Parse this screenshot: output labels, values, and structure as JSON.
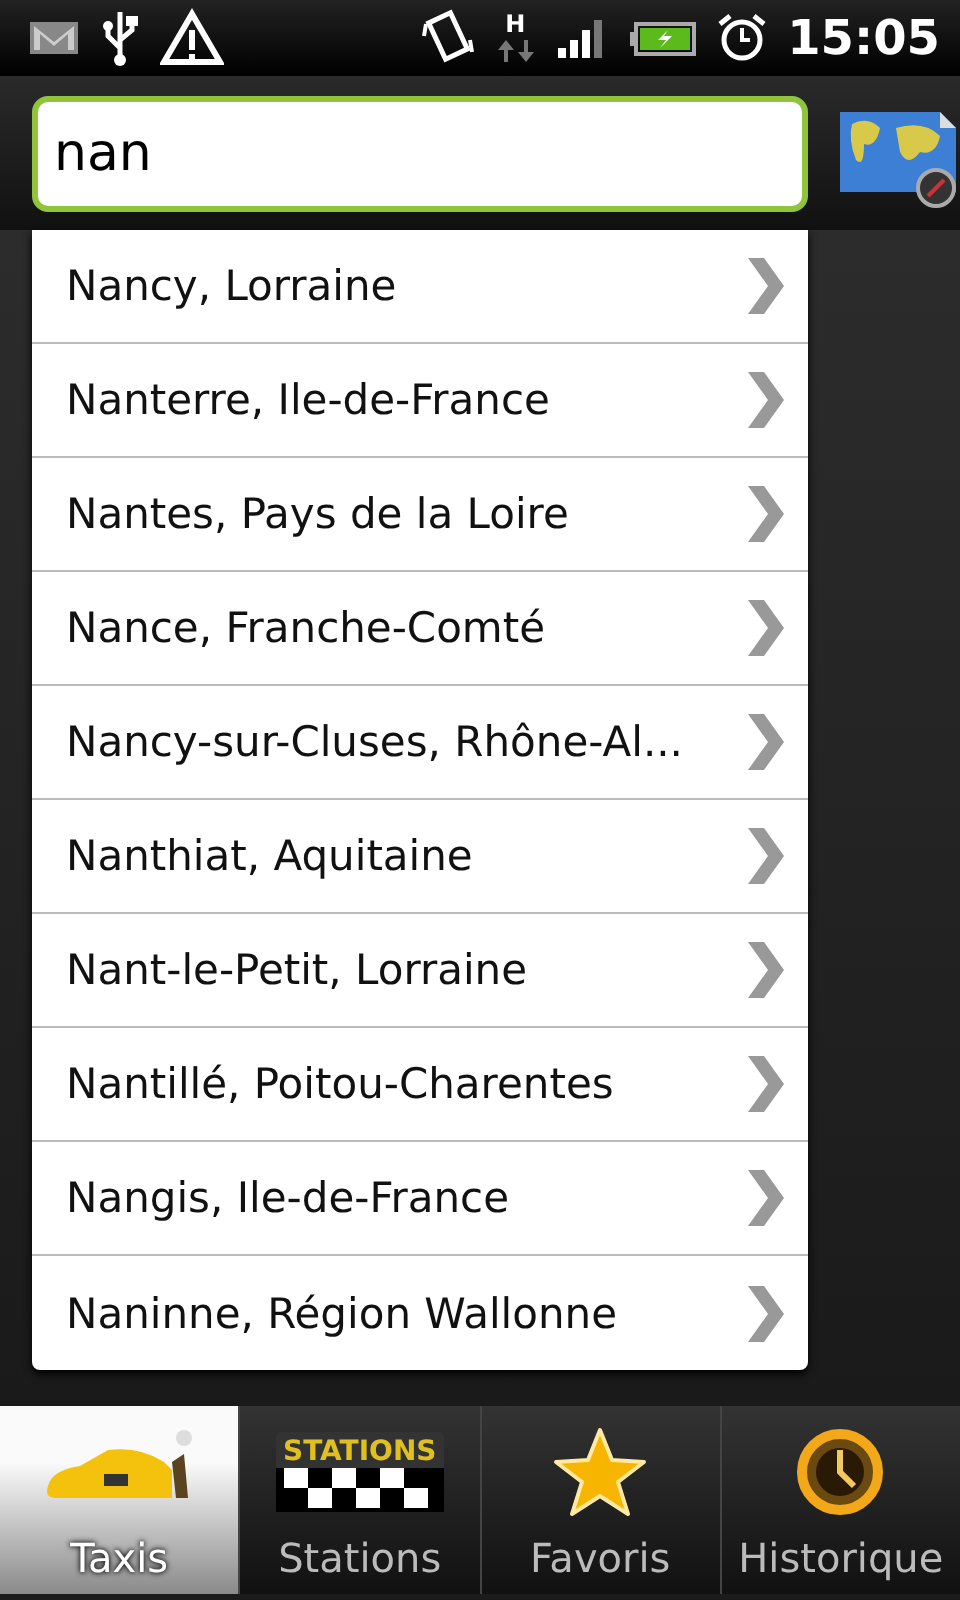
{
  "status_bar": {
    "network_type": "H",
    "time": "15:05"
  },
  "search": {
    "value": "nan"
  },
  "suggestions": [
    {
      "label": "Nancy, Lorraine"
    },
    {
      "label": "Nanterre, Ile-de-France"
    },
    {
      "label": "Nantes, Pays de la Loire"
    },
    {
      "label": "Nance, Franche-Comté"
    },
    {
      "label": "Nancy-sur-Cluses, Rhône-Al..."
    },
    {
      "label": "Nanthiat, Aquitaine"
    },
    {
      "label": "Nant-le-Petit, Lorraine"
    },
    {
      "label": "Nantillé, Poitou-Charentes"
    },
    {
      "label": "Nangis, Ile-de-France"
    },
    {
      "label": "Naninne, Région Wallonne"
    }
  ],
  "tabs": [
    {
      "label": "Taxis",
      "kind": "taxi",
      "selected": true
    },
    {
      "label": "Stations",
      "kind": "stations",
      "icon_text": "STATIONS",
      "selected": false
    },
    {
      "label": "Favoris",
      "kind": "star",
      "selected": false
    },
    {
      "label": "Historique",
      "kind": "clock",
      "selected": false
    }
  ]
}
